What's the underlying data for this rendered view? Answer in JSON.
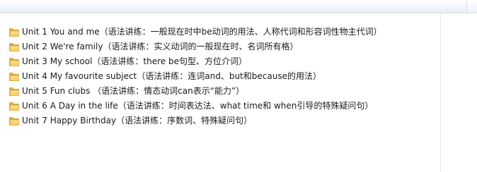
{
  "file_list": {
    "items": [
      {
        "name": "Unit 1 You and me（语法讲练：一般现在时中be动词的用法、人称代词和形容词性物主代词）",
        "icon": "folder-icon"
      },
      {
        "name": "Unit 2 We're family（语法讲练：实义动词的一般现在时、名词所有格）",
        "icon": "folder-icon"
      },
      {
        "name": "Unit 3 My school（语法讲练：there be句型、方位介词）",
        "icon": "folder-icon"
      },
      {
        "name": "Unit 4 My favourite subject（语法讲练：连词and、but和because的用法）",
        "icon": "folder-icon"
      },
      {
        "name": "Unit 5 Fun clubs （语法讲练：情态动词can表示“能力”）",
        "icon": "folder-icon"
      },
      {
        "name": "Unit 6 A Day in the life（语法讲练：时间表达法、what time和 when引导的特殊疑问句）",
        "icon": "folder-icon"
      },
      {
        "name": "Unit 7 Happy Birthday（语法讲练：序数词、特殊疑问句）",
        "icon": "folder-icon"
      }
    ]
  },
  "colors": {
    "folder_light": "#ffe49a",
    "folder_dark": "#d9a73a",
    "text": "#1a1a1a"
  }
}
